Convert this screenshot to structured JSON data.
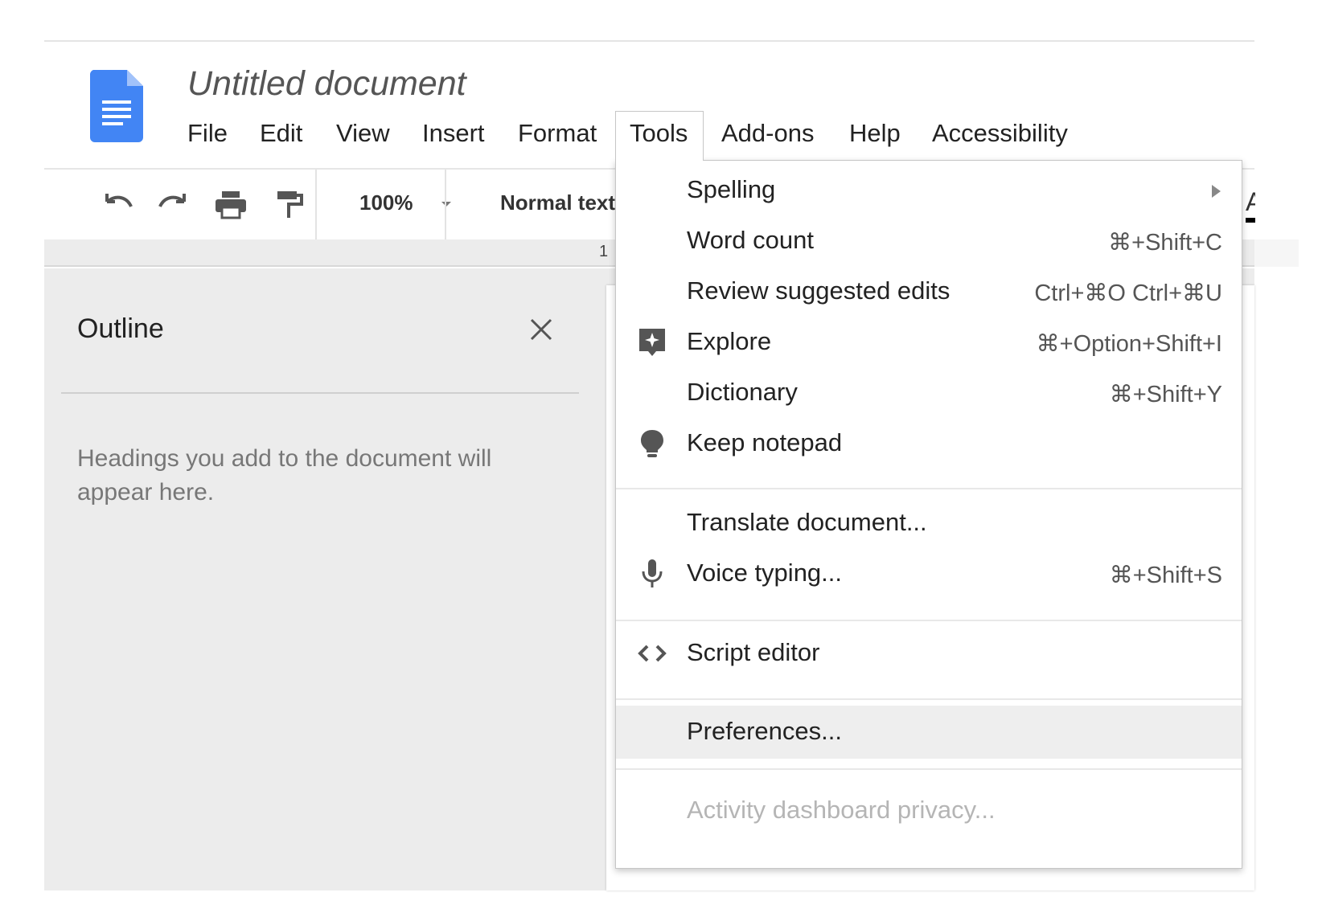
{
  "document": {
    "title": "Untitled document"
  },
  "menubar": {
    "items": [
      {
        "label": "File"
      },
      {
        "label": "Edit"
      },
      {
        "label": "View"
      },
      {
        "label": "Insert"
      },
      {
        "label": "Format"
      },
      {
        "label": "Tools",
        "active": true
      },
      {
        "label": "Add-ons"
      },
      {
        "label": "Help"
      },
      {
        "label": "Accessibility"
      }
    ]
  },
  "toolbar": {
    "icons": [
      "undo-icon",
      "redo-icon",
      "print-icon",
      "paint-format-icon"
    ],
    "zoom": "100%",
    "style": "Normal text",
    "font_partial": "A"
  },
  "ruler": {
    "mark": "1"
  },
  "outline": {
    "title": "Outline",
    "hint": "Headings you add to the document will appear here."
  },
  "tools_menu": {
    "items": [
      {
        "label": "Spelling",
        "shortcut": "",
        "submenu": true,
        "icon": ""
      },
      {
        "label": "Word count",
        "shortcut": "⌘+Shift+C",
        "icon": ""
      },
      {
        "label": "Review suggested edits",
        "shortcut": "Ctrl+⌘O Ctrl+⌘U",
        "icon": ""
      },
      {
        "label": "Explore",
        "shortcut": "⌘+Option+Shift+I",
        "icon": "explore-icon"
      },
      {
        "label": "Dictionary",
        "shortcut": "⌘+Shift+Y",
        "icon": ""
      },
      {
        "label": "Keep notepad",
        "shortcut": "",
        "icon": "lightbulb-icon"
      },
      {
        "label": "Translate document...",
        "shortcut": "",
        "icon": ""
      },
      {
        "label": "Voice typing...",
        "shortcut": "⌘+Shift+S",
        "icon": "microphone-icon"
      },
      {
        "label": "Script editor",
        "shortcut": "",
        "icon": "code-icon"
      },
      {
        "label": "Preferences...",
        "shortcut": "",
        "icon": "",
        "highlighted": true
      },
      {
        "label": "Activity dashboard privacy...",
        "shortcut": "",
        "icon": "",
        "disabled": true
      }
    ]
  },
  "colors": {
    "docs_blue": "#4285f4",
    "menu_highlight": "#eeeeee",
    "disabled_text": "#b5b5b5"
  }
}
